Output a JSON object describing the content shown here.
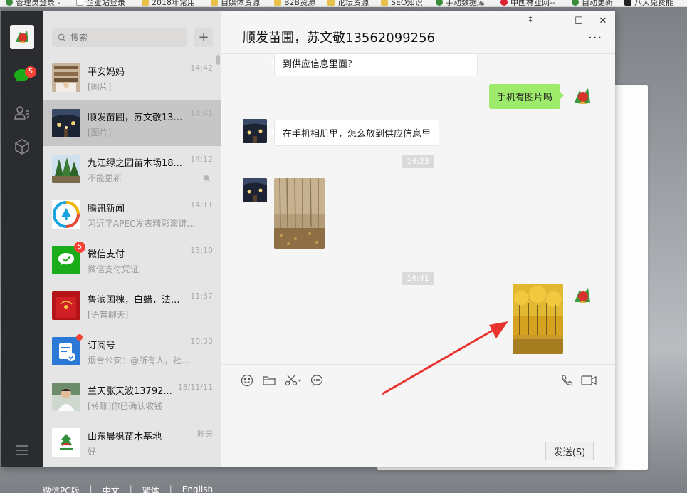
{
  "bookmarks": [
    {
      "label": "管理员登录 -",
      "icon": "g"
    },
    {
      "label": "企业站登录",
      "icon": "p"
    },
    {
      "label": "2018年常用",
      "icon": "f"
    },
    {
      "label": "自媒体资源",
      "icon": "f"
    },
    {
      "label": "B2B资源",
      "icon": "f"
    },
    {
      "label": "论坛资源",
      "icon": "f"
    },
    {
      "label": "SEO知识",
      "icon": "f"
    },
    {
      "label": "手动数据库",
      "icon": "g"
    },
    {
      "label": "中国林业网--",
      "icon": "r"
    },
    {
      "label": "自动更新",
      "icon": "g"
    },
    {
      "label": "八大免费能",
      "icon": "s"
    }
  ],
  "search": {
    "placeholder": "搜索"
  },
  "nav": {
    "unread_badge": "5"
  },
  "chats": [
    {
      "name": "平安妈妈",
      "preview": "[图片]",
      "time": "14:42",
      "avatar": "photo-shelf"
    },
    {
      "name": "顺发苗圃，苏文敬13562099256",
      "preview": "[图片]",
      "time": "14:41",
      "avatar": "night-lights"
    },
    {
      "name": "九江绿之园苗木场18...",
      "preview": "不能更新",
      "time": "14:12",
      "avatar": "trees"
    },
    {
      "name": "腾讯新闻",
      "preview": "习近平APEC发表精彩演讲...",
      "time": "14:11",
      "avatar": "tencent-news"
    },
    {
      "name": "微信支付",
      "preview": "微信支付凭证",
      "time": "13:10",
      "avatar": "wechat-pay",
      "badge": "5"
    },
    {
      "name": "鲁滨国槐，白蜡，法...",
      "preview": "[语音聊天]",
      "time": "11:37",
      "avatar": "red-cover"
    },
    {
      "name": "订阅号",
      "preview": "烟台公安：@所有人，社...",
      "time": "10:33",
      "avatar": "subscription"
    },
    {
      "name": "兰天张天波13792...",
      "preview": "[转账]你已确认收钱",
      "time": "18/11/11",
      "avatar": "person"
    },
    {
      "name": "山东晨枫苗木基地",
      "preview": "好",
      "time": "昨天",
      "avatar": "logo"
    }
  ],
  "window": {
    "title": "顺发苗圃，苏文敬13562099256",
    "pin": "⯒",
    "min": "—",
    "max": "☐",
    "close": "✕",
    "more": "···"
  },
  "messages": {
    "m1": "到供应信息里面？",
    "m2": "手机有图片吗",
    "m3": "在手机相册里，怎么放到供应信息里",
    "t1": "14:23",
    "t2": "14:41"
  },
  "input": {
    "send_label": "发送(S)"
  },
  "footer": {
    "links": [
      "微信PC版",
      "|",
      "中文",
      "|",
      "繁体",
      "|",
      "English"
    ]
  },
  "colors": {
    "accent": "#9eea6a",
    "badge": "#f44336",
    "arrow": "#e8332f"
  }
}
